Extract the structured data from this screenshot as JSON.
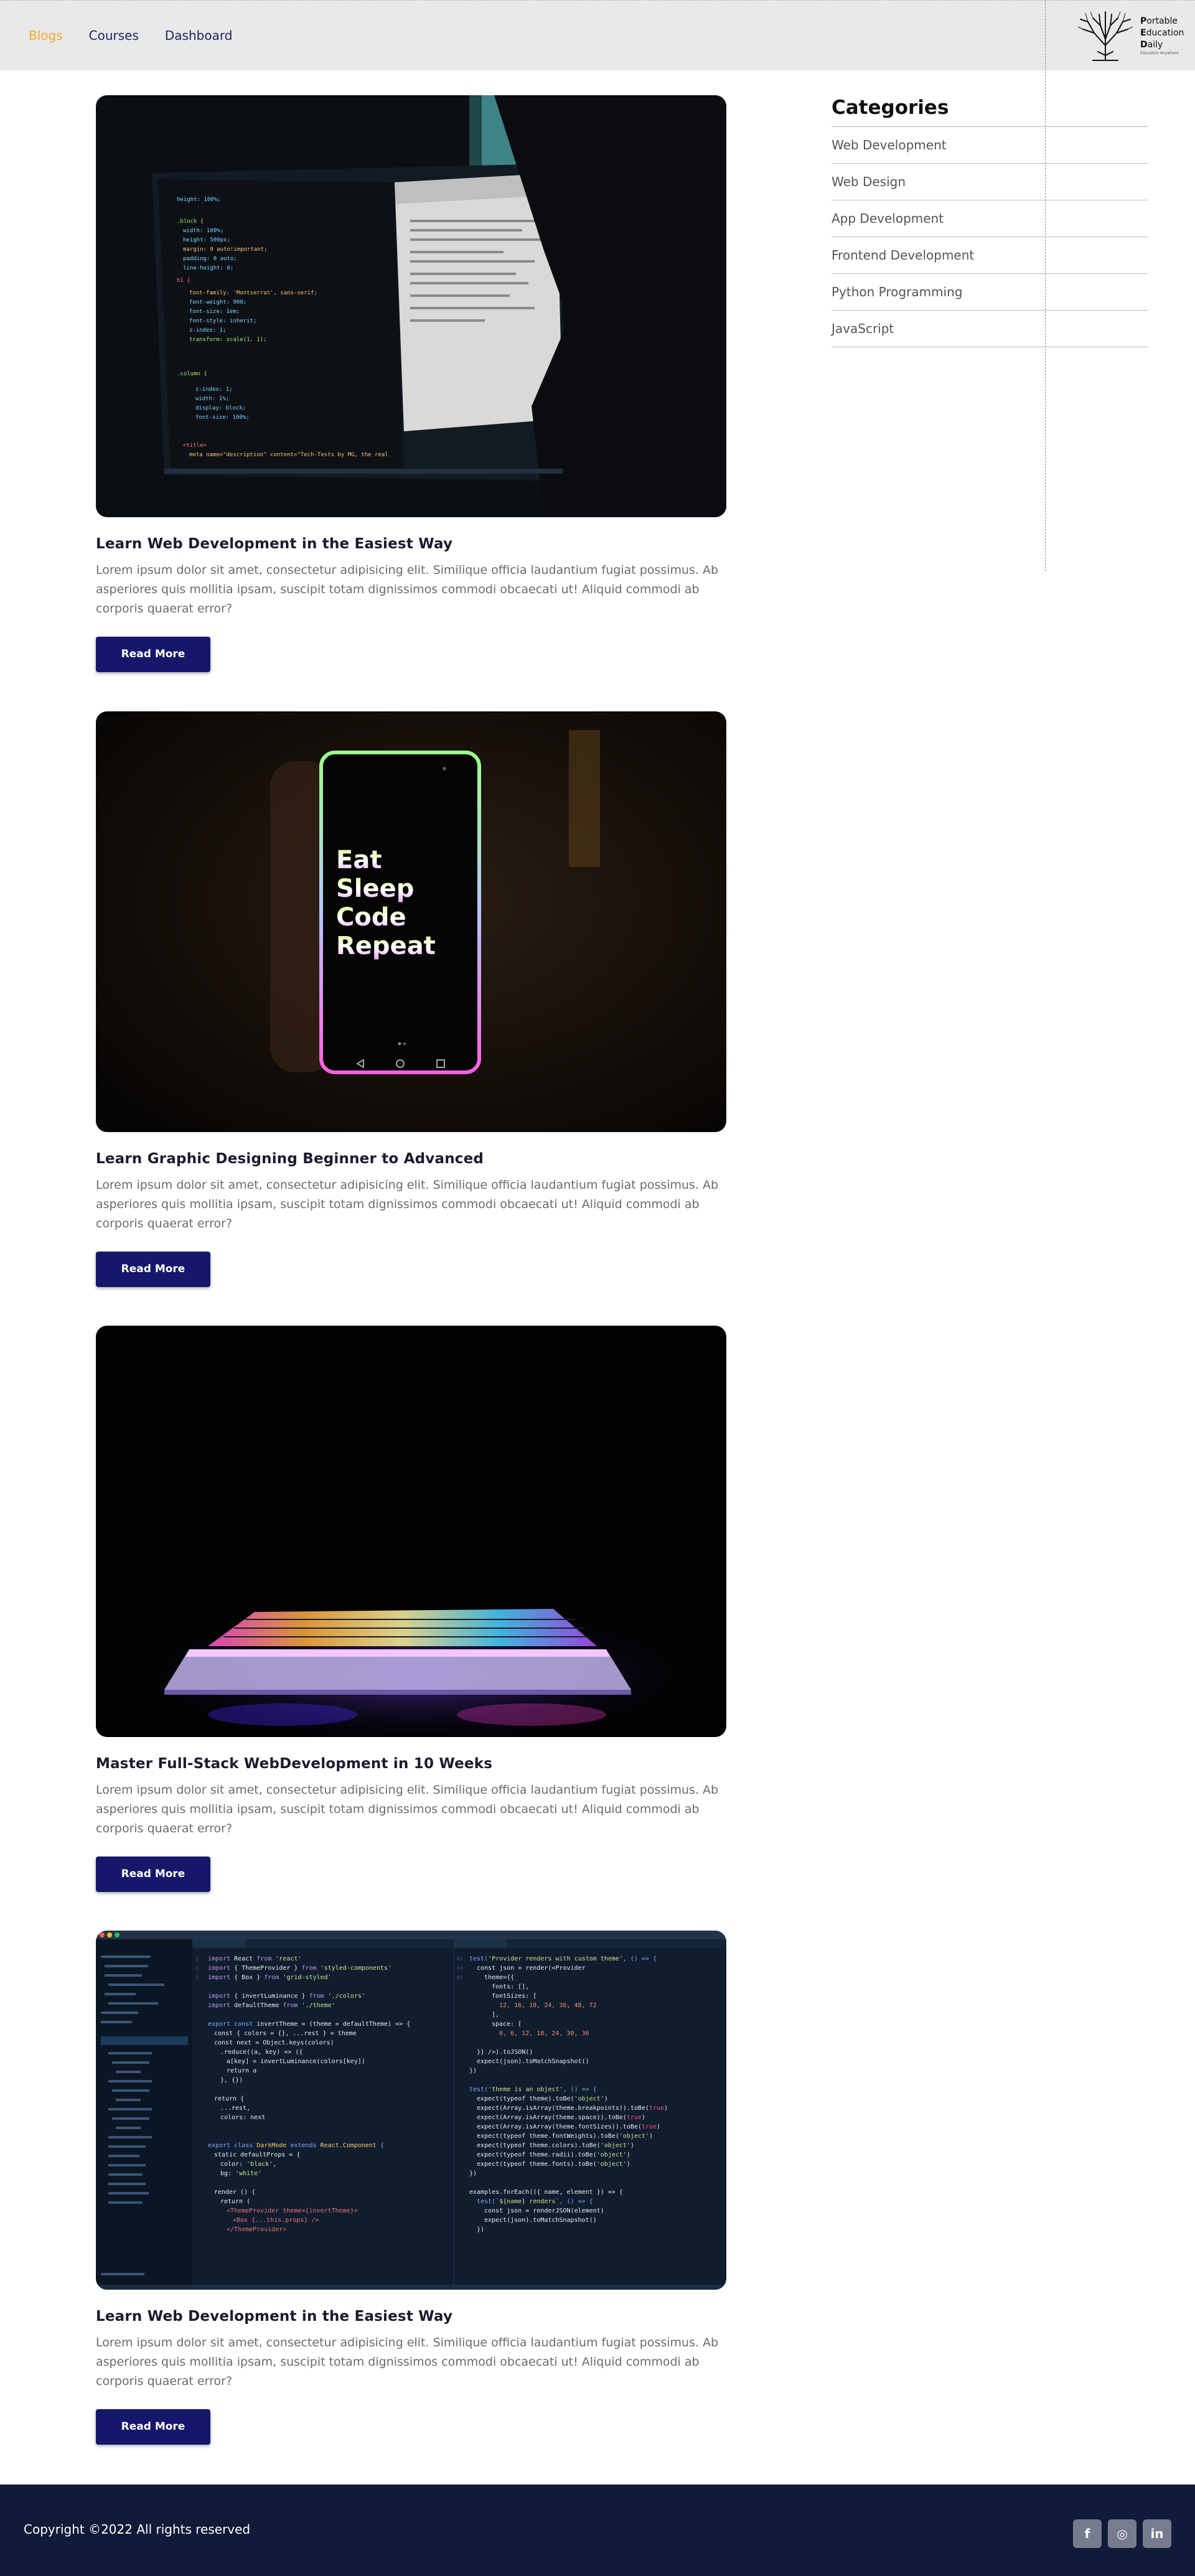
{
  "nav": {
    "items": [
      {
        "label": "Blogs",
        "active": true
      },
      {
        "label": "Courses",
        "active": false
      },
      {
        "label": "Dashboard",
        "active": false
      }
    ]
  },
  "logo": {
    "line1_initial": "P",
    "line1_rest": "ortable",
    "line2_initial": "E",
    "line2_rest": "ducation",
    "line3_initial": "D",
    "line3_rest": "aily",
    "tagline": "Education Anywhere"
  },
  "sidebar": {
    "heading": "Categories",
    "categories": [
      "Web Development",
      "Web Design",
      "App Development",
      "Frontend Development",
      "Python Programming",
      "JavaScript"
    ]
  },
  "posts": [
    {
      "title": "Learn Web Development in the Easiest Way",
      "body": "Lorem ipsum dolor sit amet, consectetur adipisicing elit. Similique officia laudantium fugiat possimus. Ab asperiores quis mollitia ipsam, suscipit totam dignissimos commodi obcaecati ut! Aliquid commodi ab corporis quaerat error?",
      "button": "Read More",
      "image_icon": "code-monitor-image"
    },
    {
      "title": "Learn Graphic Designing Beginner to Advanced",
      "body": "Lorem ipsum dolor sit amet, consectetur adipisicing elit. Similique officia laudantium fugiat possimus. Ab asperiores quis mollitia ipsam, suscipit totam dignissimos commodi obcaecati ut! Aliquid commodi ab corporis quaerat error?",
      "button": "Read More",
      "image_icon": "phone-eat-sleep-code-repeat-image",
      "phone_words": [
        "Eat",
        "Sleep",
        "Code",
        "Repeat"
      ]
    },
    {
      "title": "Master Full-Stack WebDevelopment in 10 Weeks",
      "body": "Lorem ipsum dolor sit amet, consectetur adipisicing elit. Similique officia laudantium fugiat possimus. Ab asperiores quis mollitia ipsam, suscipit totam dignissimos commodi obcaecati ut! Aliquid commodi ab corporis quaerat error?",
      "button": "Read More",
      "image_icon": "rgb-laptop-image"
    },
    {
      "title": "Learn Web Development in the Easiest Way",
      "body": "Lorem ipsum dolor sit amet, consectetur adipisicing elit. Similique officia laudantium fugiat possimus. Ab asperiores quis mollitia ipsam, suscipit totam dignissimos commodi obcaecati ut! Aliquid commodi ab corporis quaerat error?",
      "button": "Read More",
      "image_icon": "code-editor-image"
    }
  ],
  "footer": {
    "copyright": "Copyright ©2022 All rights reserved",
    "socials": [
      {
        "icon": "facebook-icon",
        "glyph": "f"
      },
      {
        "icon": "instagram-icon",
        "glyph": "◎"
      },
      {
        "icon": "linkedin-icon",
        "glyph": "in"
      }
    ]
  },
  "colors": {
    "accent": "#f6a628",
    "nav_text": "#1f2259",
    "button_bg": "#15176a",
    "footer_bg": "#111a38",
    "header_bg": "#e8e9eb"
  }
}
